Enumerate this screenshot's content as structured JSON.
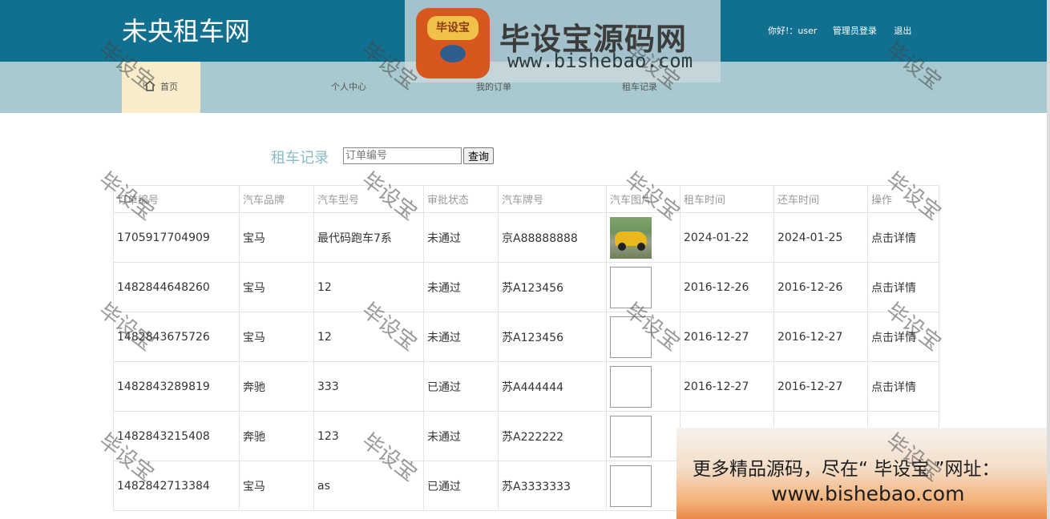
{
  "header": {
    "site_title": "未央租车网",
    "greeting": "你好!：user",
    "admin_login": "管理员登录",
    "logout": "退出"
  },
  "nav": {
    "home": "首页",
    "profile": "个人中心",
    "orders": "我的订单",
    "records": "租车记录"
  },
  "search": {
    "section_title": "租车记录",
    "placeholder": "订单编号",
    "button": "查询"
  },
  "table": {
    "headers": [
      "订单编号",
      "汽车品牌",
      "汽车型号",
      "审批状态",
      "汽车牌号",
      "汽车图片",
      "租车时间",
      "还车时间",
      "操作"
    ],
    "rows": [
      {
        "order_no": "1705917704909",
        "brand": "宝马",
        "model": "最代码跑车7系",
        "status": "未通过",
        "plate": "京A88888888",
        "rent": "2024-01-22",
        "return": "2024-01-25",
        "action": "点击详情"
      },
      {
        "order_no": "1482844648260",
        "brand": "宝马",
        "model": "12",
        "status": "未通过",
        "plate": "苏A123456",
        "rent": "2016-12-26",
        "return": "2016-12-26",
        "action": "点击详情"
      },
      {
        "order_no": "1482843675726",
        "brand": "宝马",
        "model": "12",
        "status": "未通过",
        "plate": "苏A123456",
        "rent": "2016-12-27",
        "return": "2016-12-27",
        "action": "点击详情"
      },
      {
        "order_no": "1482843289819",
        "brand": "奔驰",
        "model": "333",
        "status": "已通过",
        "plate": "苏A444444",
        "rent": "2016-12-27",
        "return": "2016-12-27",
        "action": "点击详情"
      },
      {
        "order_no": "1482843215408",
        "brand": "奔驰",
        "model": "123",
        "status": "未通过",
        "plate": "苏A222222",
        "rent": "",
        "return": "",
        "action": ""
      },
      {
        "order_no": "1482842713384",
        "brand": "宝马",
        "model": "as",
        "status": "已通过",
        "plate": "苏A3333333",
        "rent": "",
        "return": "",
        "action": ""
      }
    ]
  },
  "watermark": {
    "logo_text": "毕设宝",
    "title": "毕设宝源码网",
    "url": "www.bishebao.com",
    "stamp": "毕设宝"
  },
  "promo": {
    "line1": "更多精品源码，尽在“ 毕设宝 ”网址：",
    "line2": "www.bishebao.com"
  }
}
